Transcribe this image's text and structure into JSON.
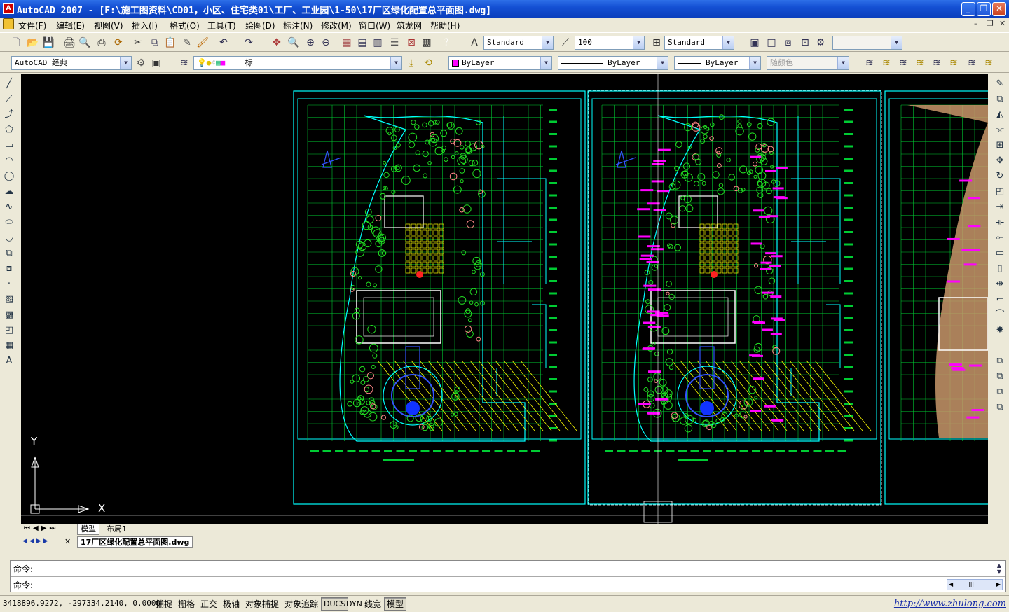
{
  "window": {
    "title": "AutoCAD 2007 - [F:\\施工图资料\\CD01，小区、住宅类01\\工厂、工业园\\1-50\\17厂区绿化配置总平面图.dwg]",
    "logo_text": "A"
  },
  "menu": {
    "items": [
      "文件(F)",
      "编辑(E)",
      "视图(V)",
      "插入(I)",
      "格式(O)",
      "工具(T)",
      "绘图(D)",
      "标注(N)",
      "修改(M)",
      "窗口(W)",
      "筑龙网",
      "帮助(H)"
    ]
  },
  "toolbar1": {
    "text_style": "Standard",
    "dim_scale": "100",
    "table_style": "Standard",
    "blank_combo": ""
  },
  "toolbar2": {
    "workspace": "AutoCAD 经典",
    "layer": "标",
    "color": "ByLayer",
    "linetype": "ByLayer",
    "lineweight": "ByLayer",
    "plotstyle": "随颜色"
  },
  "tabs": {
    "model": "模型",
    "layout1": "布局1",
    "document": "17厂区绿化配置总平面图.dwg"
  },
  "ucs": {
    "x_label": "X",
    "y_label": "Y"
  },
  "command": {
    "line1": "命令:",
    "line2": "命令:"
  },
  "status": {
    "coords": "3418896.9272, -297334.2140, 0.0000",
    "buttons": [
      "捕捉",
      "栅格",
      "正交",
      "极轴",
      "对象捕捉",
      "对象追踪",
      "DUCS",
      "DYN",
      "线宽",
      "模型"
    ],
    "url": "http://www.zhulong.com"
  },
  "colors": {
    "title_blue": "#1450d4",
    "canvas": "#000000",
    "frame_cyan": "#00ffff",
    "grid_green": "#00cc33",
    "tree_green": "#22dd22",
    "building_white": "#ffffff",
    "hatch_yellow": "#ffff00",
    "magenta_label": "#ff00ff"
  }
}
